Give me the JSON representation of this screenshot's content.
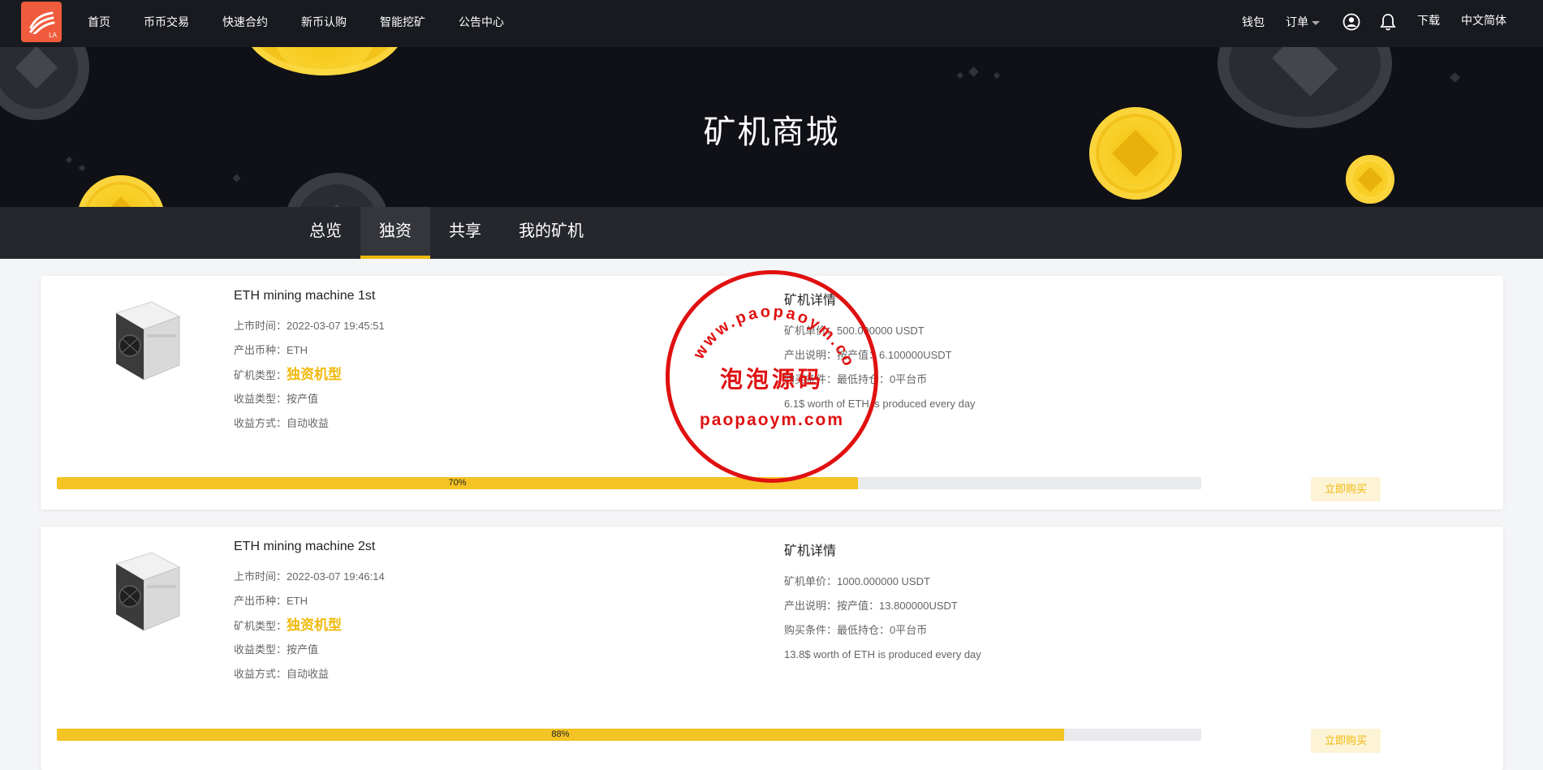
{
  "nav": {
    "logo_text": "LA",
    "links": [
      "首页",
      "币币交易",
      "快速合约",
      "新币认购",
      "智能挖矿",
      "公告中心"
    ],
    "wallet": "钱包",
    "orders": "订单",
    "download": "下载",
    "language": "中文简体"
  },
  "hero": {
    "title": "矿机商城"
  },
  "tabs": [
    "总览",
    "独资",
    "共享",
    "我的矿机"
  ],
  "active_tab": "独资",
  "colors": {
    "accent": "#f0b90b",
    "nav_bg": "#181a20",
    "progress": "#f4c324",
    "stamp": "#e01010"
  },
  "miners": [
    {
      "name": "ETH mining machine 1st",
      "listed_label": "上市时间：",
      "listed": "2022-03-07 19:45:51",
      "coin_label": "产出币种：",
      "coin": "ETH",
      "type_label": "矿机类型：",
      "type": "独资机型",
      "income_type_label": "收益类型：",
      "income_type": "按产值",
      "income_method_label": "收益方式：",
      "income_method": "自动收益",
      "detail_title": "矿机详情",
      "price_label": "矿机单价：",
      "price": "500.000000 USDT",
      "output_label": "产出说明：",
      "output": "按产值：6.100000USDT",
      "condition_label": "购买条件：",
      "condition": "最低持仓：0平台币",
      "desc": "6.1$ worth of ETH is produced every day",
      "progress": 70,
      "progress_text": "70%",
      "buy": "立即购买"
    },
    {
      "name": "ETH mining machine 2st",
      "listed_label": "上市时间：",
      "listed": "2022-03-07 19:46:14",
      "coin_label": "产出币种：",
      "coin": "ETH",
      "type_label": "矿机类型：",
      "type": "独资机型",
      "income_type_label": "收益类型：",
      "income_type": "按产值",
      "income_method_label": "收益方式：",
      "income_method": "自动收益",
      "detail_title": "矿机详情",
      "price_label": "矿机单价：",
      "price": "1000.000000 USDT",
      "output_label": "产出说明：",
      "output": "按产值：13.800000USDT",
      "condition_label": "购买条件：",
      "condition": "最低持仓：0平台币",
      "desc": "13.8$ worth of ETH is produced every day",
      "progress": 88,
      "progress_text": "88%",
      "buy": "立即购买"
    }
  ],
  "watermark": {
    "arc": "www.paopaoym.com",
    "middle": "泡泡源码",
    "bottom": "paopaoym.com"
  }
}
